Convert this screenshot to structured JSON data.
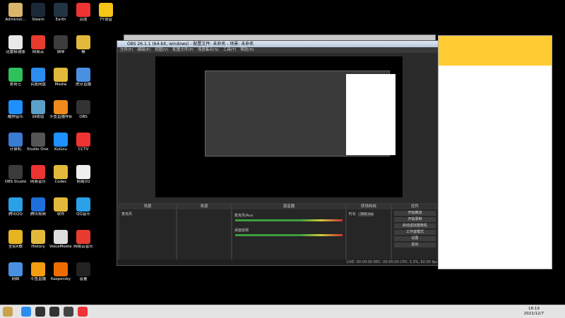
{
  "desktop_icons": [
    {
      "label": "Administ...",
      "color": "#d9b66a"
    },
    {
      "label": "迅雷极速版",
      "color": "#e8e8e8"
    },
    {
      "label": "爱奇艺",
      "color": "#2ec15c"
    },
    {
      "label": "酷狗音乐",
      "color": "#1e90ff"
    },
    {
      "label": "计算机",
      "color": "#3a7bd5"
    },
    {
      "label": "OBS Studio",
      "color": "#3b3b3b"
    },
    {
      "label": "腾讯QQ",
      "color": "#2aa0e8"
    },
    {
      "label": "全民K歌",
      "color": "#e6b422"
    },
    {
      "label": "网络",
      "color": "#4a90e2"
    },
    {
      "label": "Steam",
      "color": "#1b2838"
    },
    {
      "label": "网易云",
      "color": "#e63b2e"
    },
    {
      "label": "百度网盘",
      "color": "#2d8cf0"
    },
    {
      "label": "回收站",
      "color": "#5aa0c8"
    },
    {
      "label": "Studio One 3",
      "color": "#555"
    },
    {
      "label": "网易音乐",
      "color": "#e33"
    },
    {
      "label": "腾讯视频",
      "color": "#1e6fd9"
    },
    {
      "label": "History",
      "color": "#e2b93b"
    },
    {
      "label": "斗鱼直播",
      "color": "#f39c12"
    },
    {
      "label": "Earth",
      "color": "#234"
    },
    {
      "label": "钢琴",
      "color": "#3c3c3c"
    },
    {
      "label": "Media",
      "color": "#e2b93b"
    },
    {
      "label": "斗鱼直播伴侣",
      "color": "#f08a1c"
    },
    {
      "label": "KuGou",
      "color": "#1e90ff"
    },
    {
      "label": "Codec",
      "color": "#e2b93b"
    },
    {
      "label": "软件",
      "color": "#e2b93b"
    },
    {
      "label": "VoiceMeeter",
      "color": "#ddd"
    },
    {
      "label": "Kaspersky",
      "color": "#ef6c00"
    },
    {
      "label": "百度",
      "color": "#e33"
    },
    {
      "label": "模",
      "color": "#e2b93b"
    },
    {
      "label": "虎牙直播",
      "color": "#4a90e2"
    },
    {
      "label": "OBS",
      "color": "#333"
    },
    {
      "label": "CCTV",
      "color": "#e33"
    },
    {
      "label": "网易UU",
      "color": "#eee"
    },
    {
      "label": "QQ音乐",
      "color": "#2aa0e8"
    },
    {
      "label": "网易云音乐",
      "color": "#e63b2e"
    },
    {
      "label": "音量",
      "color": "#222"
    },
    {
      "label": "YY语音",
      "color": "#f5c518"
    }
  ],
  "obs": {
    "title": "OBS 26.1.1 (64-bit, windows) - 配置文件: 未命名 - 场景: 未命名",
    "menu": [
      "文件(F)",
      "编辑(E)",
      "视图(V)",
      "配置文件(P)",
      "场景集合(S)",
      "工具(T)",
      "帮助(H)"
    ],
    "panels": {
      "scenes": {
        "title": "场景",
        "items": [
          "麦克风"
        ]
      },
      "sources": {
        "title": "来源"
      },
      "mixer": {
        "title": "混音器",
        "tracks": [
          "麦克风/Aux",
          "桌面音频"
        ]
      },
      "transitions": {
        "title": "转场特效",
        "duration_label": "时长",
        "duration_value": "300 ms"
      },
      "controls": {
        "title": "控件",
        "buttons": [
          "开始推流",
          "开始录制",
          "启动虚拟摄像机",
          "工作室模式",
          "设置",
          "退出"
        ]
      }
    },
    "status": "LIVE: 00:00:00    REC: 00:00:00    CPU: 3.3%, 60.00 fps"
  },
  "taskbar": {
    "clock_time": "18:19",
    "clock_date": "2021/12/7"
  },
  "colors": {
    "accent": "#ffcc33",
    "obs_bg": "#2b2b2b"
  }
}
